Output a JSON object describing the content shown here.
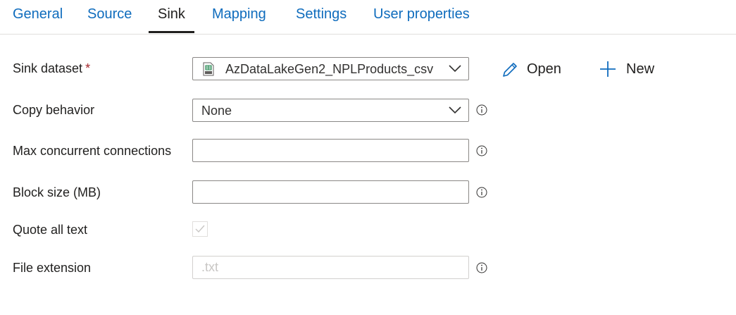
{
  "tabs": [
    {
      "label": "General"
    },
    {
      "label": "Source"
    },
    {
      "label": "Sink"
    },
    {
      "label": "Mapping"
    },
    {
      "label": "Settings"
    },
    {
      "label": "User properties"
    }
  ],
  "active_tab": "Sink",
  "sink_dataset": {
    "label": "Sink dataset",
    "required_marker": "*",
    "value": "AzDataLakeGen2_NPLProducts_csv",
    "icon": "csv-file-icon",
    "open_label": "Open",
    "new_label": "New"
  },
  "copy_behavior": {
    "label": "Copy behavior",
    "value": "None"
  },
  "max_connections": {
    "label": "Max concurrent connections",
    "value": ""
  },
  "block_size": {
    "label": "Block size (MB)",
    "value": ""
  },
  "quote_all_text": {
    "label": "Quote all text",
    "checked": true
  },
  "file_extension": {
    "label": "File extension",
    "placeholder": ".txt"
  },
  "colors": {
    "accent": "#0f6cbd",
    "required": "#a4262c",
    "text": "#201f1e"
  }
}
